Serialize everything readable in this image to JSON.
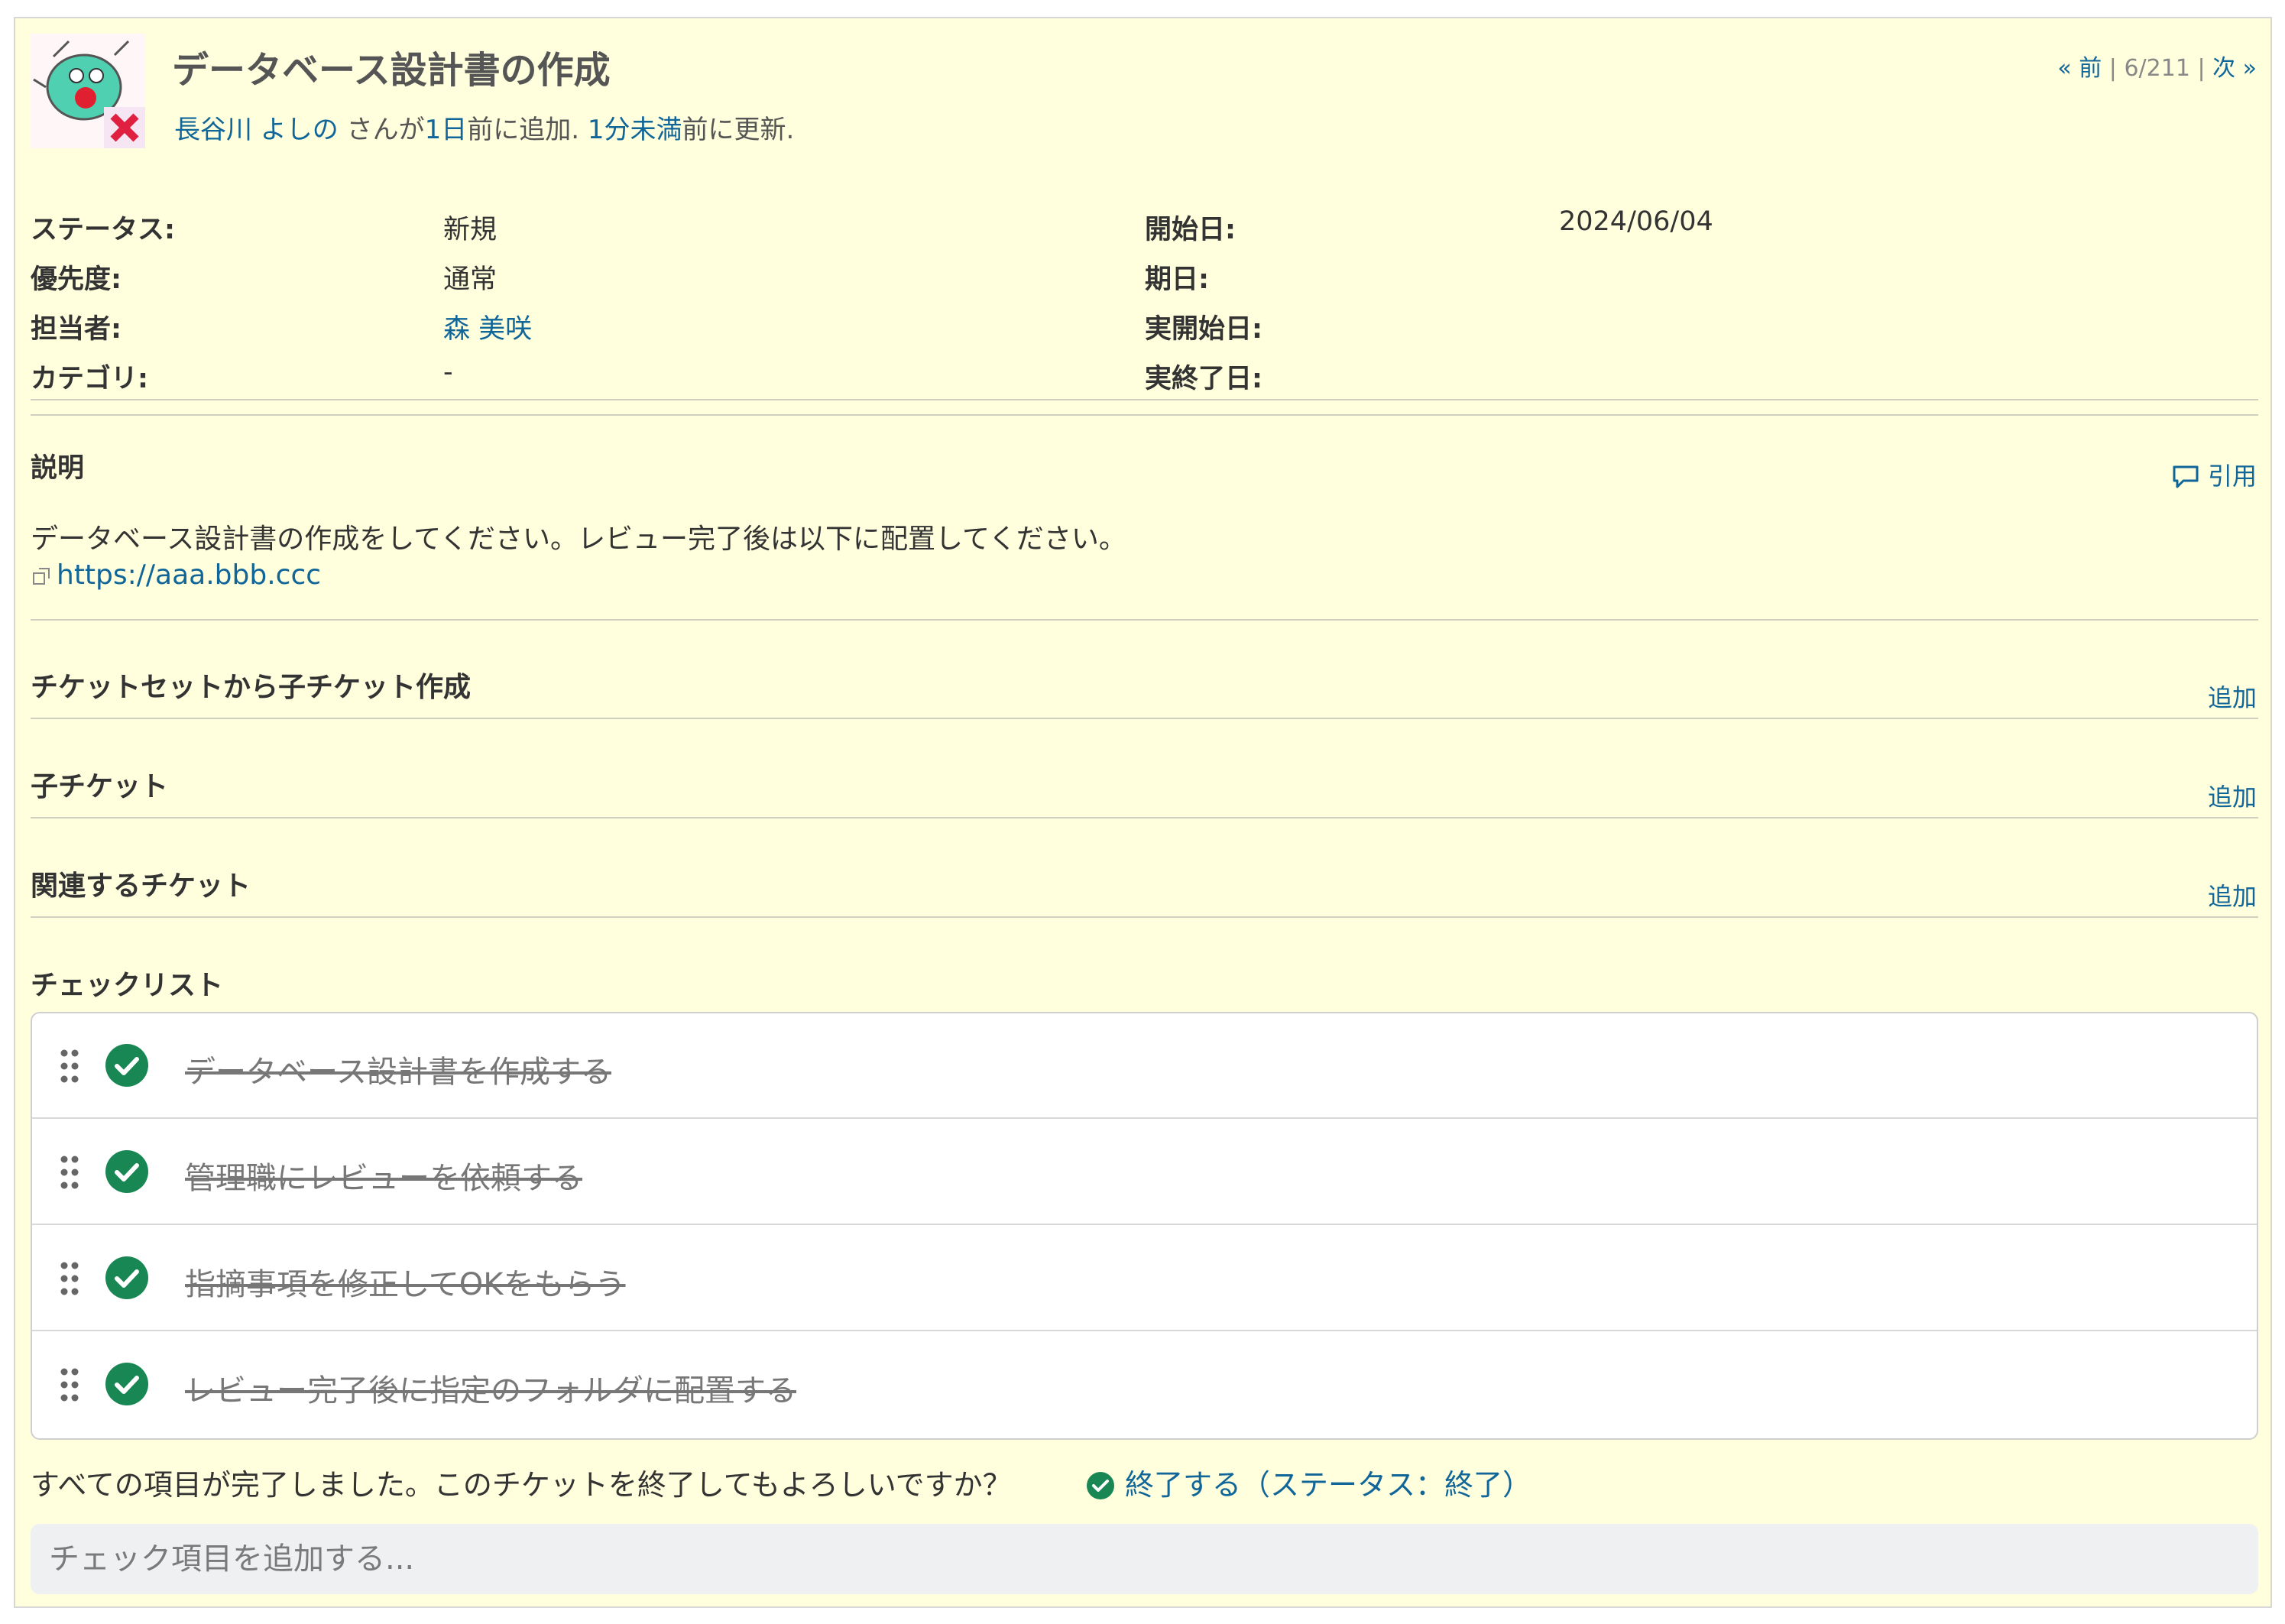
{
  "issue": {
    "title": "データベース設計書の作成",
    "meta": {
      "author": "長谷川 よしの",
      "text1": " さんが",
      "added_ago": "1日",
      "text2": "前に追加. ",
      "updated_ago": "1分未満",
      "text3": "前に更新."
    },
    "nav": {
      "prev": "« 前",
      "sep": " | ",
      "position": "6/211",
      "next": "次 »"
    }
  },
  "attributes": {
    "status_label": "ステータス:",
    "status_value": "新規",
    "priority_label": "優先度:",
    "priority_value": "通常",
    "assignee_label": "担当者:",
    "assignee_value": "森 美咲",
    "category_label": "カテゴリ:",
    "category_value": "-",
    "start_label": "開始日:",
    "start_value": "2024/06/04",
    "due_label": "期日:",
    "due_value": "",
    "actual_start_label": "実開始日:",
    "actual_start_value": "",
    "actual_end_label": "実終了日:",
    "actual_end_value": ""
  },
  "description": {
    "title": "説明",
    "quote": "引用",
    "text": "データベース設計書の作成をしてください。レビュー完了後は以下に配置してください。",
    "link": "https://aaa.bbb.ccc"
  },
  "sections": {
    "ticket_set": {
      "title": "チケットセットから子チケット作成",
      "add": "追加"
    },
    "subtasks": {
      "title": "子チケット",
      "add": "追加"
    },
    "relations": {
      "title": "関連するチケット",
      "add": "追加"
    },
    "checklist": {
      "title": "チェックリスト"
    }
  },
  "checklist_items": [
    {
      "text": "データベース設計書を作成する",
      "done": true
    },
    {
      "text": "管理職にレビューを依頼する",
      "done": true
    },
    {
      "text": "指摘事項を修正してOKをもらう",
      "done": true
    },
    {
      "text": "レビュー完了後に指定のフォルダに配置する",
      "done": true
    }
  ],
  "checklist_footer": {
    "done_message": "すべての項目が完了しました。このチケットを終了してもよろしいですか？",
    "close_action": "終了する（ステータス：終了）",
    "add_placeholder": "チェック項目を追加する..."
  },
  "colors": {
    "background": "#ffffdd",
    "link": "#116699",
    "check": "#198754"
  },
  "icons": [
    "avatar-icon",
    "comment-icon",
    "external-link-icon",
    "drag-handle-icon",
    "check-circle-icon"
  ]
}
